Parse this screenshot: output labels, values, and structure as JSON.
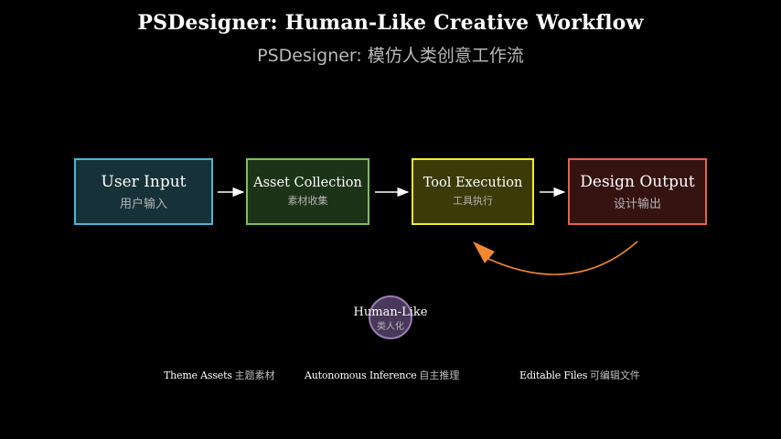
{
  "header": {
    "title": "PSDesigner: Human-Like Creative Workflow",
    "subtitle": "PSDesigner: 模仿人类创意工作流"
  },
  "nodes": [
    {
      "en": "User Input",
      "zh": "用户输入",
      "border": "#4fb5d6",
      "fill": "#163238"
    },
    {
      "en": "Asset Collection",
      "zh": "素材收集",
      "border": "#7fbf5a",
      "fill": "#1d3318"
    },
    {
      "en": "Tool Execution",
      "zh": "工具执行",
      "border": "#f2ec2a",
      "fill": "#3c3a06"
    },
    {
      "en": "Design Output",
      "zh": "设计输出",
      "border": "#e8614e",
      "fill": "#351310"
    }
  ],
  "center": {
    "en": "Human-Like",
    "zh": "类人化",
    "border": "#9b7bb5",
    "fill": "#49385a"
  },
  "features": [
    {
      "en": "Theme Assets",
      "zh": "主题素材"
    },
    {
      "en": "Autonomous Inference",
      "zh": "自主推理"
    },
    {
      "en": "Editable Files",
      "zh": "可编辑文件"
    }
  ],
  "colors": {
    "background": "#000000",
    "arrow": "#ffffff",
    "feedback_arrow": "#f2872f"
  }
}
